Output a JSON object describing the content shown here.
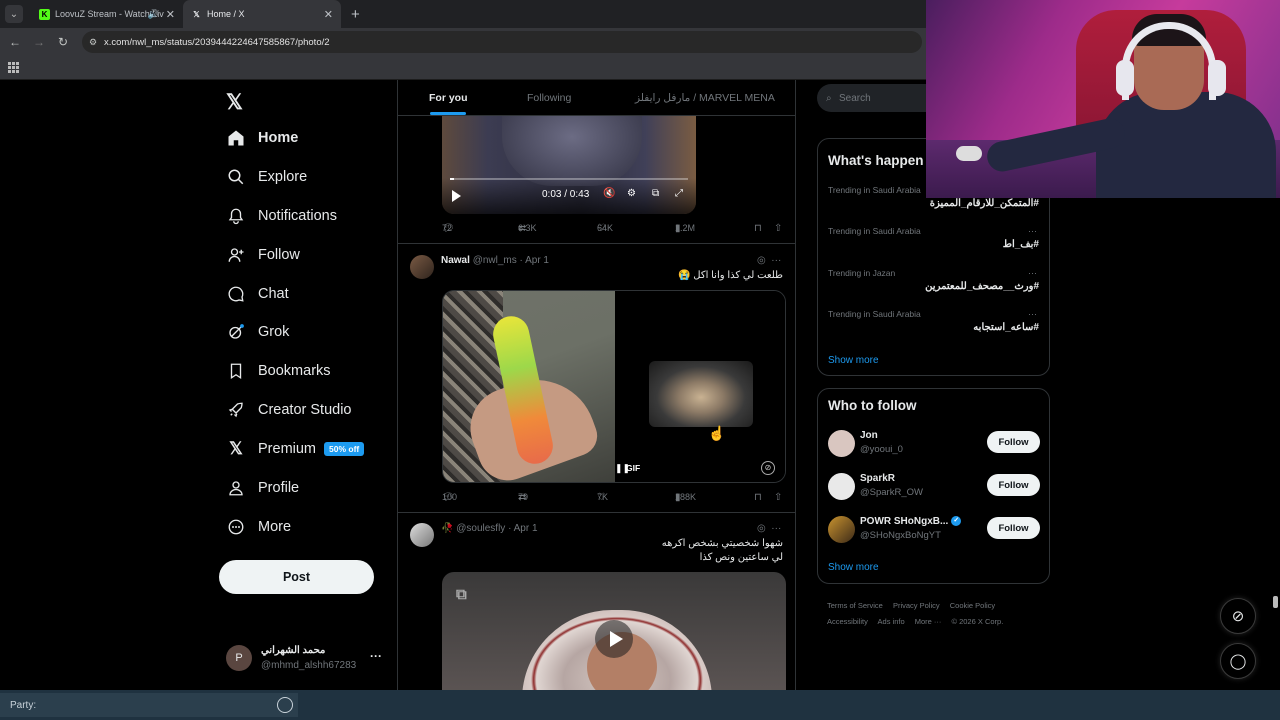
{
  "browser": {
    "tabs": [
      {
        "label": "LoovuZ Stream - Watch Liv",
        "favicon": "K",
        "favicon_color": "#53fc18"
      },
      {
        "label": "Home / X",
        "favicon": "𝕏",
        "favicon_color": "#e7e9ea"
      }
    ],
    "url": "x.com/nwl_ms/status/2039444224647585867/photo/2",
    "new_tab": "+",
    "tab_dropdown": "⌄"
  },
  "nav": {
    "logo": "𝕏",
    "items": [
      {
        "label": "Home",
        "icon": "home-icon"
      },
      {
        "label": "Explore",
        "icon": "search-icon"
      },
      {
        "label": "Notifications",
        "icon": "bell-icon"
      },
      {
        "label": "Follow",
        "icon": "add-person-icon"
      },
      {
        "label": "Chat",
        "icon": "chat-icon"
      },
      {
        "label": "Grok",
        "icon": "grok-icon"
      },
      {
        "label": "Bookmarks",
        "icon": "bookmark-icon"
      },
      {
        "label": "Creator Studio",
        "icon": "rocket-icon"
      },
      {
        "label": "Premium",
        "icon": "x-icon",
        "badge": "50% off"
      },
      {
        "label": "Profile",
        "icon": "person-icon"
      },
      {
        "label": "More",
        "icon": "more-circle-icon"
      }
    ],
    "post_label": "Post",
    "account": {
      "name": "محمد الشهراني",
      "handle": "@mhmd_alshh67283",
      "initial": "P",
      "more": "···"
    }
  },
  "feed": {
    "tabs": [
      {
        "label": "For you",
        "active": true
      },
      {
        "label": "Following",
        "active": false
      },
      {
        "label": "مارفل رايفلز / MARVEL MENA",
        "active": false
      }
    ],
    "video1": {
      "time": "0:03 / 0:43",
      "actions": {
        "replies": "72",
        "reposts": "6.3K",
        "likes": "64K",
        "views": "1.2M"
      }
    },
    "post2": {
      "name": "Nawal",
      "handle": "@nwl_ms",
      "date": "· Apr 1",
      "text": "طلعت لي كذا وانا اكل 😭",
      "gif_label": "GIF",
      "actions": {
        "replies": "100",
        "reposts": "79",
        "likes": "7K",
        "views": "188K"
      }
    },
    "post3": {
      "name": "🥀",
      "handle": "@soulesfly",
      "date": "· Apr 1",
      "text_line1": "شهوا شخصيتي بشخص اكرهه",
      "text_line2": "لي ساعتين ونص كذا"
    }
  },
  "sidebar": {
    "search_placeholder": "Search",
    "trends_title": "What's happen",
    "trends": [
      {
        "context": "Trending in Saudi Arabia",
        "tag": "#المتمكن_للارقام_المميزة"
      },
      {
        "context": "Trending in Saudi Arabia",
        "tag": "#بف_اط"
      },
      {
        "context": "Trending in Jazan",
        "tag": "#ورث__مصحف_للمعتمرين"
      },
      {
        "context": "Trending in Saudi Arabia",
        "tag": "#ساعه_استجابه"
      }
    ],
    "show_more": "Show more",
    "wtf_title": "Who to follow",
    "who_to_follow": [
      {
        "name": "Jon",
        "handle": "@yooui_0",
        "button": "Follow",
        "avatar_color": "#d9c6c0"
      },
      {
        "name": "SparkR",
        "handle": "@SparkR_OW",
        "button": "Follow",
        "avatar_color": "#e9e9e9"
      },
      {
        "name": "POWR SHoNgxB...",
        "handle": "@SHoNgxBoNgYT",
        "button": "Follow",
        "avatar_color": "#6a4a2a",
        "verified": true
      }
    ],
    "footer": [
      "Terms of Service",
      "Privacy Policy",
      "Cookie Policy",
      "Accessibility",
      "Ads info",
      "More ···",
      "© 2026 X Corp."
    ]
  },
  "taskbar": {
    "party_label": "Party:"
  }
}
